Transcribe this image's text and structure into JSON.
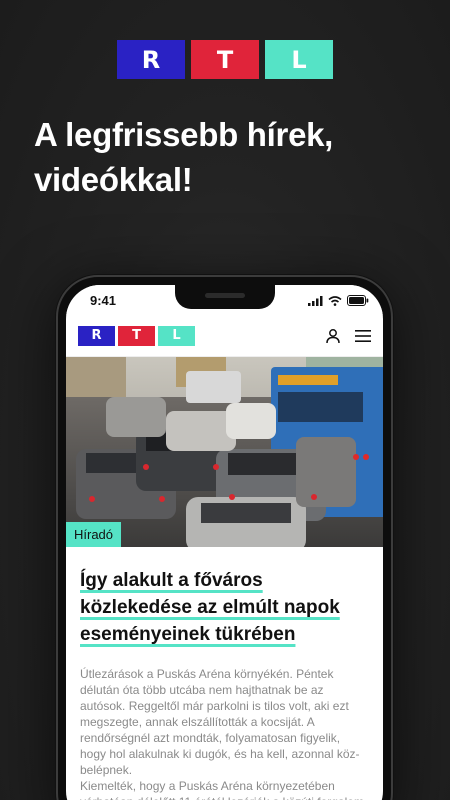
{
  "brand": {
    "letters": [
      "R",
      "T",
      "L"
    ],
    "colors": [
      "#2a22c4",
      "#e0243a",
      "#55e3c6"
    ]
  },
  "headline": "A legfrissebb hírek, videókkal!",
  "phone": {
    "status": {
      "time": "9:41"
    },
    "header": {
      "user_icon": "user-icon",
      "menu_icon": "menu-icon"
    },
    "article": {
      "category": "Híradó",
      "title": "Így alakult a főváros közlekedése az elmúlt napok eseményeinek tükrében",
      "body_p1": "Útlezárások a Puskás Aréna környékén. Péntek délután óta több utcába nem hajthatnak be az autósok. Reggeltől már parkolni is tilos volt, aki ezt megszegte, annak elszállították a kocsiját. A rendőrségnél azt mondták, folyamatosan figyelik, hogy hol alakulnak ki dugók, és ha kell, azonnal köz-belépnek.",
      "body_p2": "Kiemelték, hogy a Puskás Aréna környezetében várhatóan délelőtt 11 órától lezárják a közúti forgalom"
    }
  }
}
